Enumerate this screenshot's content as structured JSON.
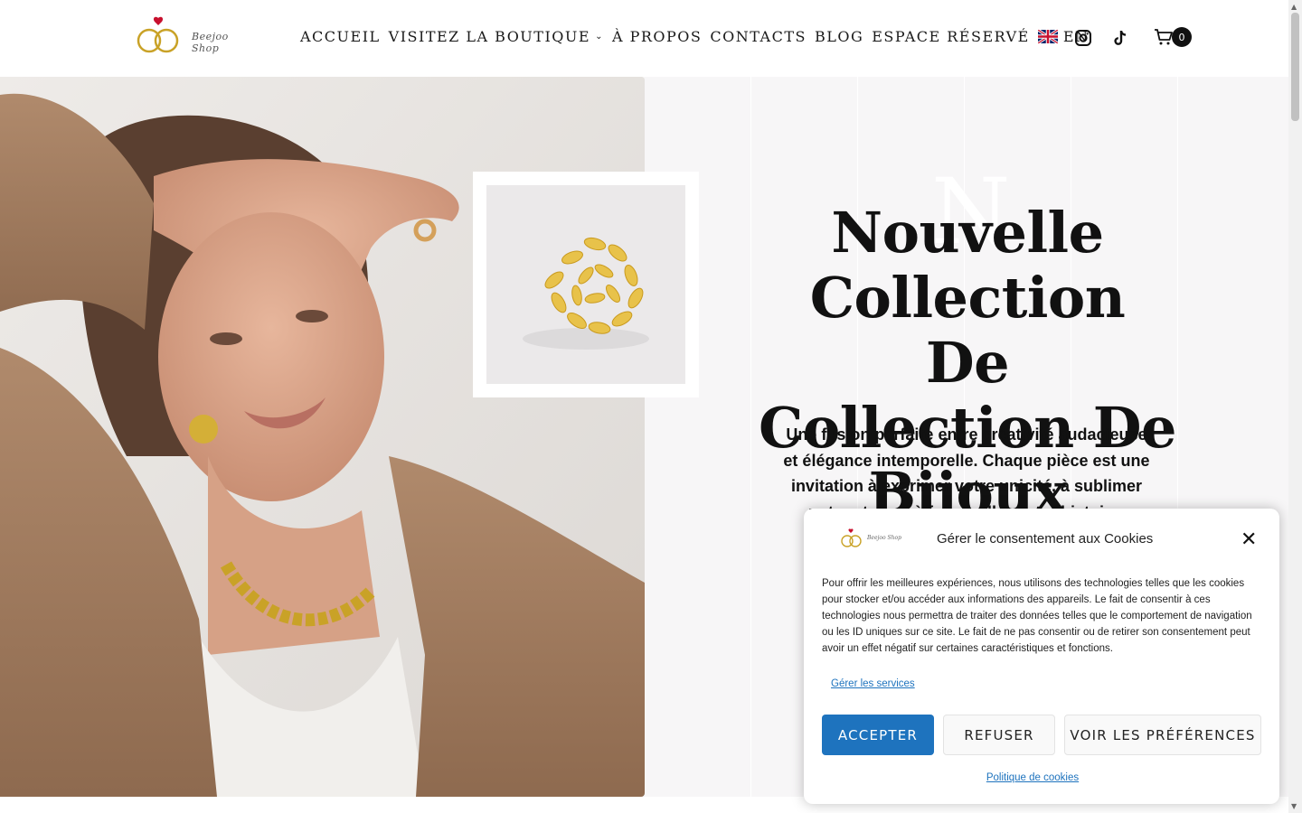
{
  "header": {
    "logo_text": "Beejoo Shop",
    "nav": [
      {
        "label": "ACCUEIL"
      },
      {
        "label": "VISITEZ LA BOUTIQUE"
      },
      {
        "label": "À PROPOS"
      },
      {
        "label": "CONTACTS"
      },
      {
        "label": "BLOG"
      },
      {
        "label": "ESPACE RÉSERVÉ"
      },
      {
        "label": "EN"
      }
    ],
    "icons": [
      "instagram-icon",
      "tiktok-icon",
      "cart-icon"
    ],
    "cart_count": "0"
  },
  "hero": {
    "bg_letter": "N",
    "title_line1": "Nouvelle Collection",
    "title_line2": "De",
    "title_line3": "Collection De Bijoux",
    "description": "Une fusion parfaite entre créativité audacieuse et élégance intemporelle. Chaque pièce est une invitation à exprimer votre unicité, à sublimer votre style et à faire briller votre histoire."
  },
  "cookie": {
    "logo_text": "Beejoo Shop",
    "title": "Gérer le consentement aux Cookies",
    "text": "Pour offrir les meilleures expériences, nous utilisons des technologies telles que les cookies pour stocker et/ou accéder aux informations des appareils. Le fait de consentir à ces technologies nous permettra de traiter des données telles que le comportement de navigation ou les ID uniques sur ce site. Le fait de ne pas consentir ou de retirer son consentement peut avoir un effet négatif sur certaines caractéristiques et fonctions.",
    "manage_link": "Gérer les services",
    "accept": "ACCEPTER",
    "refuse": "REFUSER",
    "preferences": "VOIR LES PRÉFÉRENCES",
    "policy_link": "Politique de cookies"
  },
  "colors": {
    "accent": "#1e73be",
    "hero_bg": "#f7f6f7",
    "gold": "#c9a227"
  }
}
